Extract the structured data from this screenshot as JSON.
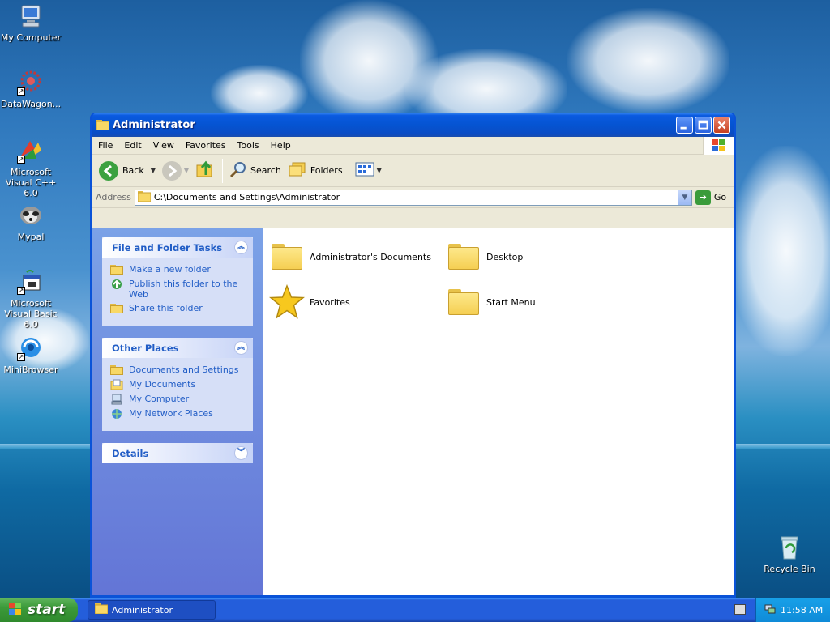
{
  "desktop": {
    "icons": [
      {
        "label": "My Computer"
      },
      {
        "label": "DataWagon..."
      },
      {
        "label": "Microsoft Visual C++ 6.0"
      },
      {
        "label": "Mypal"
      },
      {
        "label": "Microsoft Visual Basic 6.0"
      },
      {
        "label": "MiniBrowser"
      },
      {
        "label": "Recycle Bin"
      }
    ]
  },
  "window": {
    "title": "Administrator",
    "menu": [
      "File",
      "Edit",
      "View",
      "Favorites",
      "Tools",
      "Help"
    ],
    "toolbar": {
      "back": "Back",
      "search": "Search",
      "folders": "Folders"
    },
    "address": {
      "label": "Address",
      "value": "C:\\Documents and Settings\\Administrator",
      "go": "Go"
    },
    "tasks_panel": {
      "title": "File and Folder Tasks",
      "items": [
        "Make a new folder",
        "Publish this folder to the Web",
        "Share this folder"
      ]
    },
    "places_panel": {
      "title": "Other Places",
      "items": [
        "Documents and Settings",
        "My Documents",
        "My Computer",
        "My Network Places"
      ]
    },
    "details_panel": {
      "title": "Details"
    },
    "files": [
      {
        "label": "Administrator's Documents",
        "icon": "folder-icon"
      },
      {
        "label": "Desktop",
        "icon": "folder-icon"
      },
      {
        "label": "Favorites",
        "icon": "star-icon"
      },
      {
        "label": "Start Menu",
        "icon": "folder-icon"
      }
    ]
  },
  "taskbar": {
    "start": "start",
    "task": "Administrator",
    "clock": "11:58 AM"
  },
  "colors": {
    "accent": "#0a53d8",
    "link": "#215dc6"
  }
}
